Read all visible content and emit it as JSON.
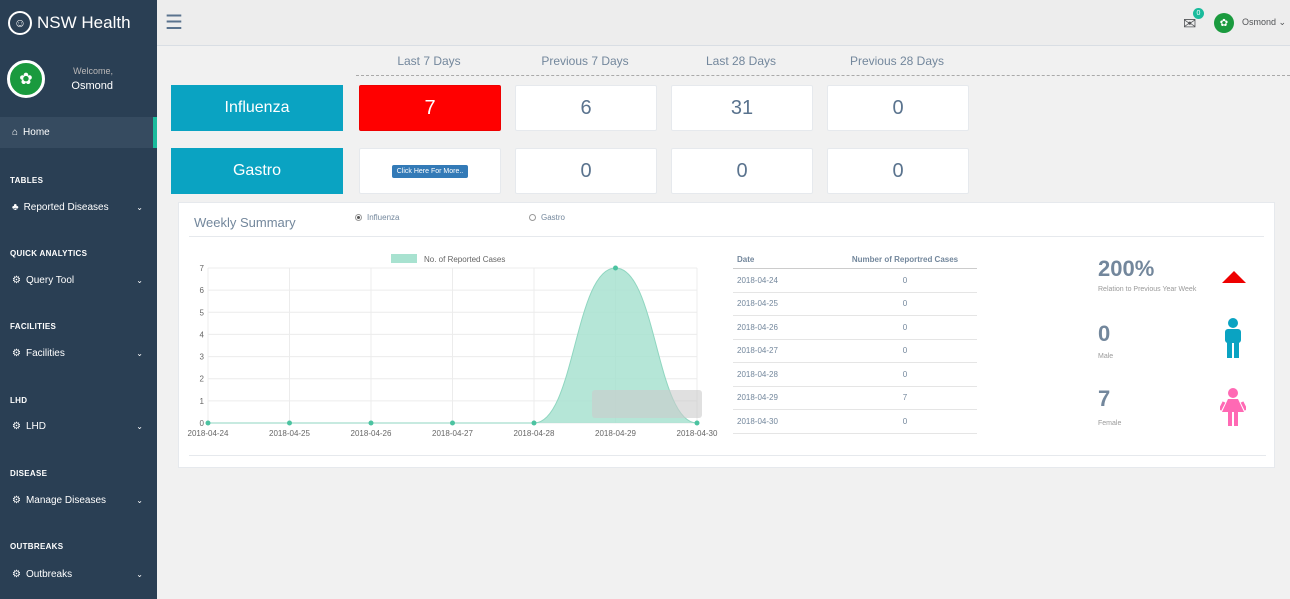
{
  "brand": {
    "title": "NSW Health"
  },
  "profile": {
    "welcome": "Welcome,",
    "name": "Osmond"
  },
  "sidebar": {
    "home": "Home",
    "sections": [
      {
        "title": "TABLES",
        "item": "Reported Diseases"
      },
      {
        "title": "QUICK ANALYTICS",
        "item": "Query Tool"
      },
      {
        "title": "FACILITIES",
        "item": "Facilities"
      },
      {
        "title": "LHD",
        "item": "LHD"
      },
      {
        "title": "DISEASE",
        "item": "Manage Diseases"
      },
      {
        "title": "OUTBREAKS",
        "item": "Outbreaks"
      }
    ]
  },
  "topbar": {
    "badge": "0",
    "user": "Osmond"
  },
  "columns": [
    "Last 7 Days",
    "Previous 7 Days",
    "Last 28 Days",
    "Previous 28 Days"
  ],
  "influenza": {
    "label": "Influenza",
    "last7": "7",
    "prev7": "6",
    "last28": "31",
    "prev28": "0"
  },
  "gastro": {
    "label": "Gastro",
    "more": "Click Here For More..",
    "prev7": "0",
    "last28": "0",
    "prev28": "0"
  },
  "summary": {
    "title": "Weekly Summary",
    "radio1": "Influenza",
    "radio2": "Gastro"
  },
  "table": {
    "h1": "Date",
    "h2": "Number of Reportred Cases",
    "rows": [
      [
        "2018-04-24",
        "0"
      ],
      [
        "2018-04-25",
        "0"
      ],
      [
        "2018-04-26",
        "0"
      ],
      [
        "2018-04-27",
        "0"
      ],
      [
        "2018-04-28",
        "0"
      ],
      [
        "2018-04-29",
        "7"
      ],
      [
        "2018-04-30",
        "0"
      ]
    ]
  },
  "stats": {
    "pct": "200%",
    "pct_label": "Relation to Previous Year Week",
    "male": "0",
    "male_label": "Male",
    "female": "7",
    "female_label": "Female"
  },
  "colors": {
    "accent": "#1abb9c",
    "sidebar": "#2a3f54",
    "area": "#a8e2d0",
    "red": "#ff0000",
    "blue_icon": "#0aa3c2",
    "pink_icon": "#ff69b4"
  },
  "chart_data": {
    "type": "area",
    "legend": "No. of Reported Cases",
    "x": [
      "2018-04-24",
      "2018-04-25",
      "2018-04-26",
      "2018-04-27",
      "2018-04-28",
      "2018-04-29",
      "2018-04-30"
    ],
    "values": [
      0,
      0,
      0,
      0,
      0,
      7,
      0
    ],
    "yticks": [
      0,
      1,
      2,
      3,
      4,
      5,
      6,
      7
    ],
    "ylim": [
      0,
      7
    ]
  }
}
